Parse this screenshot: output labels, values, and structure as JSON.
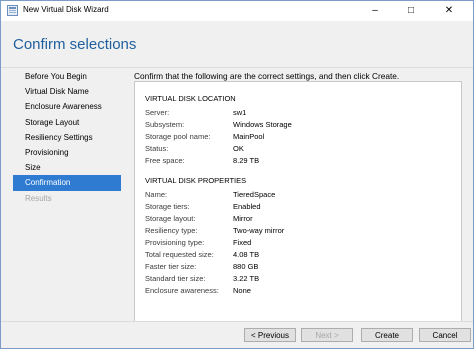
{
  "window": {
    "title": "New Virtual Disk Wizard",
    "minimize": "–",
    "maximize": "□",
    "close": "✕"
  },
  "header": {
    "title": "Confirm selections"
  },
  "nav": [
    {
      "label": "Before You Begin",
      "state": "normal"
    },
    {
      "label": "Virtual Disk Name",
      "state": "normal"
    },
    {
      "label": "Enclosure Awareness",
      "state": "normal"
    },
    {
      "label": "Storage Layout",
      "state": "normal"
    },
    {
      "label": "Resiliency Settings",
      "state": "normal"
    },
    {
      "label": "Provisioning",
      "state": "normal"
    },
    {
      "label": "Size",
      "state": "normal"
    },
    {
      "label": "Confirmation",
      "state": "active"
    },
    {
      "label": "Results",
      "state": "disabled"
    }
  ],
  "content": {
    "intro": "Confirm that the following are the correct settings, and then click Create.",
    "location": {
      "title": "VIRTUAL DISK LOCATION",
      "rows": [
        {
          "k": "Server:",
          "v": "sw1"
        },
        {
          "k": "Subsystem:",
          "v": "Windows Storage"
        },
        {
          "k": "Storage pool name:",
          "v": "MainPool"
        },
        {
          "k": "Status:",
          "v": "OK"
        },
        {
          "k": "Free space:",
          "v": "8.29 TB"
        }
      ]
    },
    "properties": {
      "title": "VIRTUAL DISK PROPERTIES",
      "rows": [
        {
          "k": "Name:",
          "v": "TieredSpace"
        },
        {
          "k": "Storage tiers:",
          "v": "Enabled"
        },
        {
          "k": "Storage layout:",
          "v": "Mirror"
        },
        {
          "k": "Resiliency type:",
          "v": "Two-way mirror"
        },
        {
          "k": "Provisioning type:",
          "v": "Fixed"
        },
        {
          "k": "Total requested size:",
          "v": "4.08 TB"
        },
        {
          "k": "Faster tier size:",
          "v": "880 GB"
        },
        {
          "k": "Standard tier size:",
          "v": "3.22 TB"
        },
        {
          "k": "Enclosure awareness:",
          "v": "None"
        }
      ]
    }
  },
  "footer": {
    "previous": "< Previous",
    "next": "Next >",
    "create": "Create",
    "cancel": "Cancel"
  }
}
